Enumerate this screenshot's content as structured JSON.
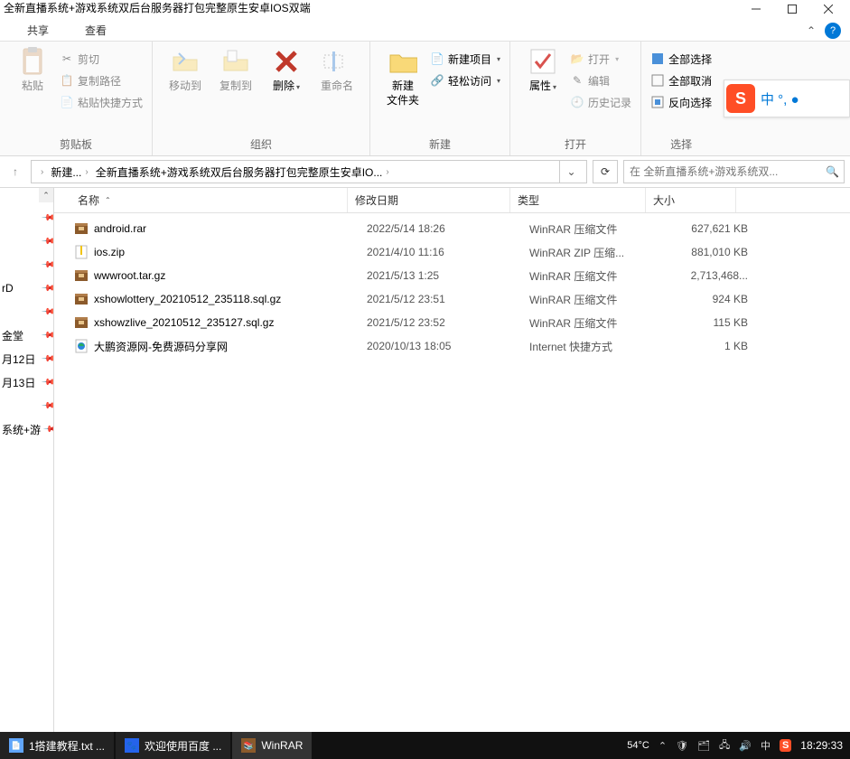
{
  "window": {
    "title": "全新直播系统+游戏系统双后台服务器打包完整原生安卓IOS双端"
  },
  "tabs": {
    "share": "共享",
    "view": "查看"
  },
  "ribbon": {
    "clipboard": {
      "paste": "粘贴",
      "cut": "剪切",
      "copypath": "复制路径",
      "pasteshortcut": "粘贴快捷方式",
      "label": "剪贴板"
    },
    "organize": {
      "moveto": "移动到",
      "copyto": "复制到",
      "delete": "删除",
      "rename": "重命名",
      "label": "组织"
    },
    "new": {
      "newfolder": "新建\n文件夹",
      "newitem": "新建项目",
      "easyaccess": "轻松访问",
      "label": "新建"
    },
    "open": {
      "properties": "属性",
      "open": "打开",
      "edit": "编辑",
      "history": "历史记录",
      "label": "打开"
    },
    "select": {
      "selectall": "全部选择",
      "selectnone": "全部取消",
      "invert": "反向选择",
      "label": "选择"
    }
  },
  "breadcrumb": {
    "up": "↑",
    "parts": [
      "新建...",
      "全新直播系统+游戏系统双后台服务器打包完整原生安卓IO..."
    ]
  },
  "search": {
    "placeholder": "在 全新直播系统+游戏系统双..."
  },
  "nav": {
    "items": [
      "",
      "",
      "",
      "rD",
      "",
      "金堂",
      "月12日",
      "月13日",
      "",
      "系统+游"
    ]
  },
  "columns": {
    "name": "名称",
    "date": "修改日期",
    "type": "类型",
    "size": "大小"
  },
  "files": [
    {
      "icon": "rar",
      "name": "android.rar",
      "date": "2022/5/14 18:26",
      "type": "WinRAR 压缩文件",
      "size": "627,621 KB"
    },
    {
      "icon": "zip",
      "name": "ios.zip",
      "date": "2021/4/10 11:16",
      "type": "WinRAR ZIP 压缩...",
      "size": "881,010 KB"
    },
    {
      "icon": "rar",
      "name": "wwwroot.tar.gz",
      "date": "2021/5/13 1:25",
      "type": "WinRAR 压缩文件",
      "size": "2,713,468..."
    },
    {
      "icon": "rar",
      "name": "xshowlottery_20210512_235118.sql.gz",
      "date": "2021/5/12 23:51",
      "type": "WinRAR 压缩文件",
      "size": "924 KB"
    },
    {
      "icon": "rar",
      "name": "xshowzlive_20210512_235127.sql.gz",
      "date": "2021/5/12 23:52",
      "type": "WinRAR 压缩文件",
      "size": "115 KB"
    },
    {
      "icon": "url",
      "name": "大鹏资源网-免费源码分享网",
      "date": "2020/10/13 18:05",
      "type": "Internet 快捷方式",
      "size": "1 KB"
    }
  ],
  "ime": {
    "text": "中 °, ●"
  },
  "taskbar": {
    "items": [
      {
        "label": "1搭建教程.txt ..."
      },
      {
        "label": "欢迎使用百度 ..."
      },
      {
        "label": "WinRAR"
      }
    ],
    "weather": "54°C",
    "clock": "18:29:33"
  }
}
